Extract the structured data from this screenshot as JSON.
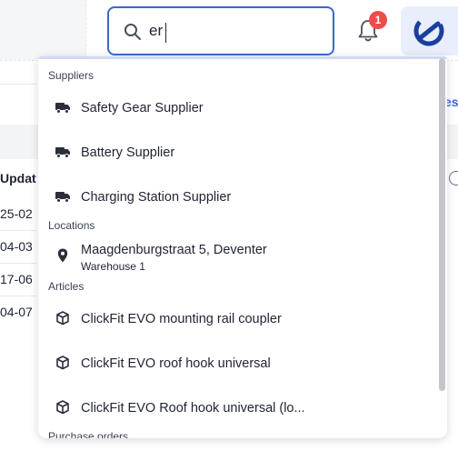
{
  "search": {
    "value": "er"
  },
  "notifications": {
    "count": "1"
  },
  "background": {
    "link_text": "es",
    "column_header": "Updat",
    "cells": [
      "25-02",
      "04-03",
      "17-06",
      "04-07"
    ]
  },
  "dropdown": {
    "sections": {
      "suppliers": "Suppliers",
      "locations": "Locations",
      "articles": "Articles",
      "purchase_orders": "Purchase orders"
    },
    "suppliers": [
      {
        "label": "Safety Gear Supplier",
        "icon": "truck-icon"
      },
      {
        "label": "Battery Supplier",
        "icon": "truck-icon"
      },
      {
        "label": "Charging Station Supplier",
        "icon": "truck-icon"
      }
    ],
    "locations": [
      {
        "label": "Maagdenburgstraat 5, Deventer",
        "sublabel": "Warehouse 1",
        "icon": "location-pin-icon"
      }
    ],
    "articles": [
      {
        "label": "ClickFit EVO mounting rail coupler",
        "icon": "box-icon"
      },
      {
        "label": "ClickFit EVO roof hook universal",
        "icon": "box-icon"
      },
      {
        "label": "ClickFit EVO Roof hook universal (lo...",
        "icon": "box-icon"
      }
    ]
  },
  "colors": {
    "accent": "#3b66d6",
    "badge": "#ef4b4b"
  }
}
